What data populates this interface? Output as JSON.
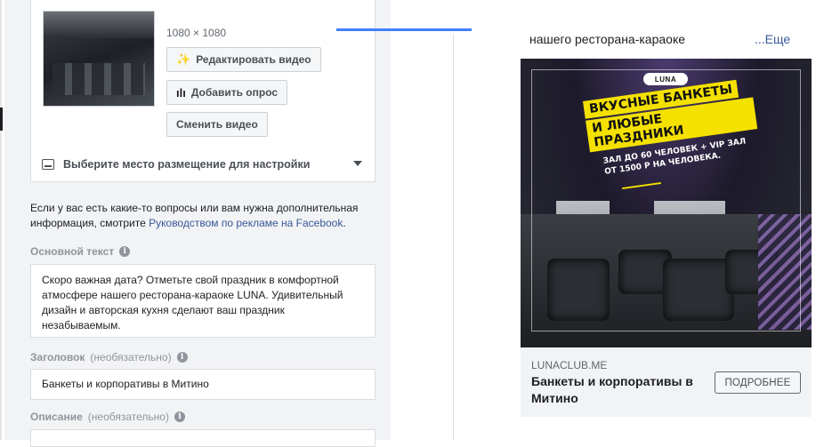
{
  "editor": {
    "video_size": "1080 × 1080",
    "buttons": {
      "edit_video": "Редактировать видео",
      "add_poll": "Добавить опрос",
      "change_video": "Сменить видео"
    },
    "placement_select": "Выберите место размещение для настройки",
    "info_text_prefix": "Если у вас есть какие-то вопросы или вам нужна дополнительная информация, смотрите ",
    "info_link": "Руководством по рекламе на Facebook",
    "info_text_suffix": ".",
    "primary_text_label": "Основной текст",
    "primary_text_value": "Скоро важная дата? Отметьте свой праздник в комфортной атмосфере нашего ресторана-караоке LUNA. Удивительный дизайн и авторская кухня сделают ваш праздник незабываемым.",
    "headline_label": "Заголовок",
    "headline_optional": "(необязательно)",
    "headline_value": "Банкеты и корпоративы в Митино",
    "description_label": "Описание",
    "description_optional": "(необязательно)"
  },
  "preview": {
    "text_snippet": "нашего ресторана-караоке",
    "more_link": "...Еще",
    "image": {
      "logo": "LUNA",
      "banner_line1": "ВКУСНЫЕ БАНКЕТЫ",
      "banner_line2": "И ЛЮБЫЕ ПРАЗДНИКИ",
      "sub_line1": "ЗАЛ ДО 60 ЧЕЛОВЕК + VIP ЗАЛ",
      "sub_line2": "ОТ 1500 Р НА ЧЕЛОВЕКА."
    },
    "domain": "LUNACLUB.ME",
    "headline": "Банкеты и корпоративы в Митино",
    "cta": "ПОДРОБНЕЕ"
  },
  "colors": {
    "link": "#385898",
    "tab_accent": "#4080ff",
    "banner_yellow": "#f5e100"
  }
}
